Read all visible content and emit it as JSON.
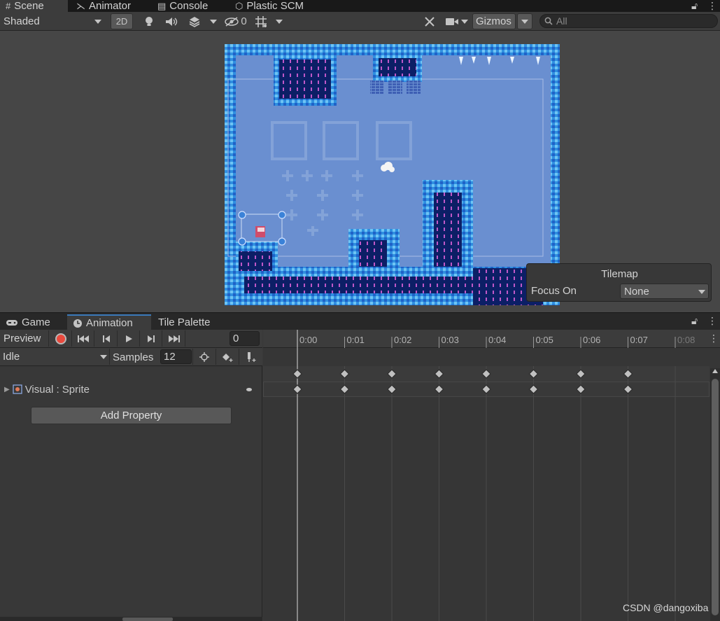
{
  "top_tabs": [
    {
      "label": "Scene",
      "icon": "grid-icon"
    },
    {
      "label": "Animator",
      "icon": "animator-icon"
    },
    {
      "label": "Console",
      "icon": "console-icon"
    },
    {
      "label": "Plastic SCM",
      "icon": "plastic-scm-icon"
    }
  ],
  "scene_toolbar": {
    "shading_mode": "Shaded",
    "mode_2d_label": "2D",
    "hidden_count": "0",
    "gizmos_label": "Gizmos",
    "search_placeholder": "All"
  },
  "tilemap_overlay": {
    "title": "Tilemap",
    "focus_label": "Focus On",
    "focus_value": "None"
  },
  "bottom_tabs": [
    {
      "label": "Game",
      "icon": "gamepad-icon"
    },
    {
      "label": "Animation",
      "icon": "clock-icon"
    },
    {
      "label": "Tile Palette",
      "icon": ""
    }
  ],
  "animation": {
    "preview_label": "Preview",
    "current_frame": "0",
    "clip_name": "Idle",
    "samples_label": "Samples",
    "samples_value": "12",
    "property_label": "Visual : Sprite",
    "add_property_label": "Add Property",
    "ruler_ticks": [
      "0:00",
      "0:01",
      "0:02",
      "0:03",
      "0:04",
      "0:05",
      "0:06",
      "0:07",
      "0:08"
    ],
    "keyframes": [
      0,
      1,
      2,
      3,
      4,
      5,
      6,
      7
    ]
  },
  "watermark": "CSDN @dangoxiba",
  "colors": {
    "record_button": "#e9493d",
    "active_tab_accent": "#3a79bb",
    "level_sky": "#6a8fd0",
    "ice_border": "#3ea2e6",
    "dark_tile": "#0a1e5e"
  }
}
